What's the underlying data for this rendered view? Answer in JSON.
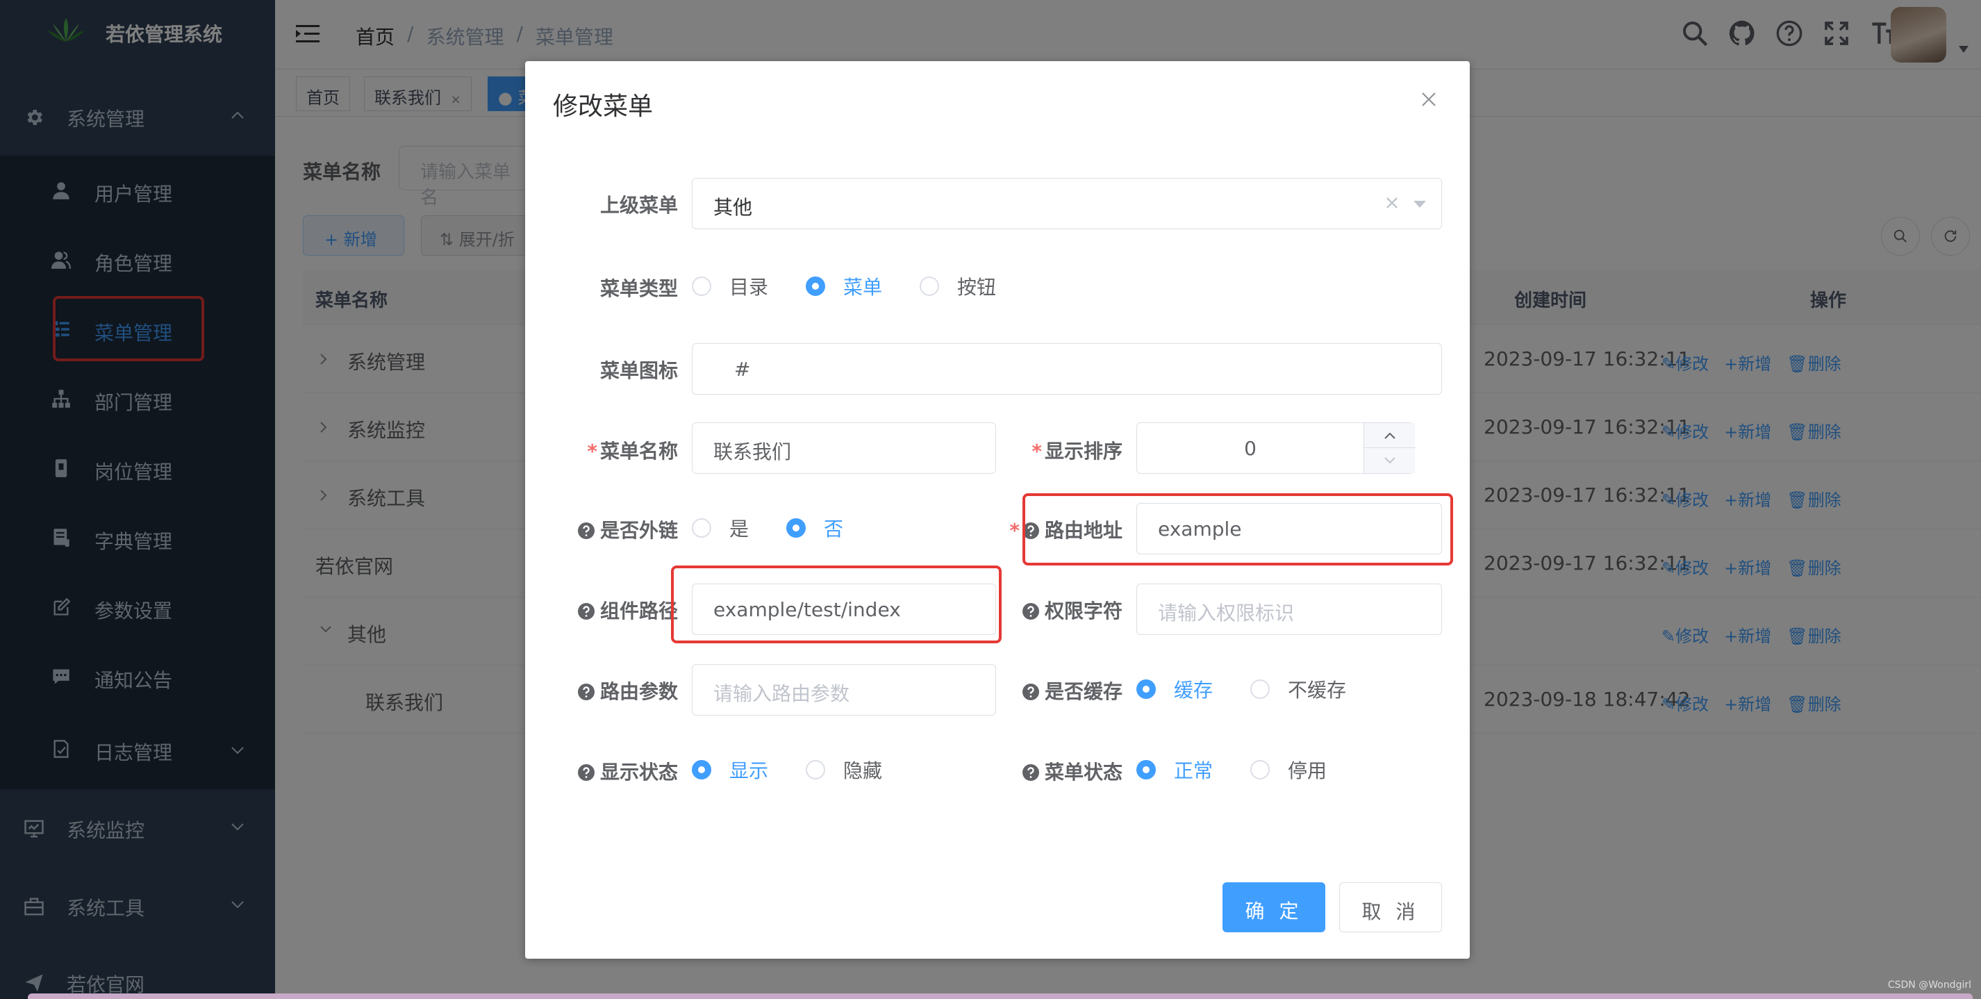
{
  "app": {
    "title": "若依管理系统"
  },
  "sidebar": {
    "groups": [
      {
        "label": "系统管理",
        "icon": "gear-icon"
      },
      {
        "label": "系统监控",
        "icon": "monitor-icon"
      },
      {
        "label": "系统工具",
        "icon": "toolbox-icon"
      },
      {
        "label": "若依官网",
        "icon": "send-icon"
      }
    ],
    "items": [
      {
        "label": "用户管理",
        "icon": "user-icon"
      },
      {
        "label": "角色管理",
        "icon": "users-icon"
      },
      {
        "label": "菜单管理",
        "icon": "tree-table-icon",
        "active": true
      },
      {
        "label": "部门管理",
        "icon": "tree-icon"
      },
      {
        "label": "岗位管理",
        "icon": "post-icon"
      },
      {
        "label": "字典管理",
        "icon": "dict-icon"
      },
      {
        "label": "参数设置",
        "icon": "edit-icon"
      },
      {
        "label": "通知公告",
        "icon": "message-icon"
      },
      {
        "label": "日志管理",
        "icon": "log-icon"
      }
    ]
  },
  "navbar": {
    "breadcrumb": [
      "首页",
      "系统管理",
      "菜单管理"
    ],
    "separator": "/",
    "icons": [
      "search-icon",
      "github-icon",
      "question-icon",
      "fullscreen-icon",
      "font-size-icon"
    ]
  },
  "tags": [
    {
      "label": "首页"
    },
    {
      "label": "联系我们",
      "close": "×"
    },
    {
      "label": "● 菜",
      "active": true
    }
  ],
  "page": {
    "search_label": "菜单名称",
    "search_placeholder": "请输入菜单名",
    "add_label": "+ 新增",
    "expand_label": "⇅ 展开/折",
    "columns": {
      "name": "菜单名称",
      "created": "创建时间",
      "ops": "操作"
    },
    "ops": {
      "edit": "修改",
      "add": "新增",
      "delete": "删除"
    },
    "rows": [
      {
        "name": "系统管理",
        "created": "2023-09-17 16:32:11",
        "expandable": true
      },
      {
        "name": "系统监控",
        "created": "2023-09-17 16:32:11",
        "expandable": true
      },
      {
        "name": "系统工具",
        "created": "2023-09-17 16:32:11",
        "expandable": true
      },
      {
        "name": "若依官网",
        "created": "2023-09-17 16:32:11",
        "expandable": false
      },
      {
        "name": "其他",
        "created": "",
        "expandable": true,
        "expanded": true
      },
      {
        "name": "联系我们",
        "created": "2023-09-18 18:47:42",
        "expandable": false
      }
    ]
  },
  "dialog": {
    "title": "修改菜单",
    "close": "×",
    "parent_label": "上级菜单",
    "parent_value": "其他",
    "type_label": "菜单类型",
    "type_options": [
      "目录",
      "菜单",
      "按钮"
    ],
    "type_selected": "菜单",
    "icon_label": "菜单图标",
    "icon_value": "#",
    "name_label": "菜单名称",
    "name_value": "联系我们",
    "order_label": "显示排序",
    "order_value": "0",
    "external_label": "是否外链",
    "external_options": [
      "是",
      "否"
    ],
    "external_selected": "否",
    "route_label": "路由地址",
    "route_value": "example",
    "component_label": "组件路径",
    "component_value": "example/test/index",
    "perm_label": "权限字符",
    "perm_placeholder": "请输入权限标识",
    "query_label": "路由参数",
    "query_placeholder": "请输入路由参数",
    "cache_label": "是否缓存",
    "cache_options": [
      "缓存",
      "不缓存"
    ],
    "cache_selected": "缓存",
    "visible_label": "显示状态",
    "visible_options": [
      "显示",
      "隐藏"
    ],
    "visible_selected": "显示",
    "status_label": "菜单状态",
    "status_options": [
      "正常",
      "停用"
    ],
    "status_selected": "正常",
    "required_mark": "*",
    "ok_label": "确 定",
    "cancel_label": "取 消"
  },
  "watermark": "CSDN @Wondgirl",
  "colors": {
    "primary": "#409eff",
    "sidebar_bg": "#304156",
    "submenu_bg": "#1f2d3d",
    "highlight": "#e53935",
    "required": "#f56c6c"
  }
}
